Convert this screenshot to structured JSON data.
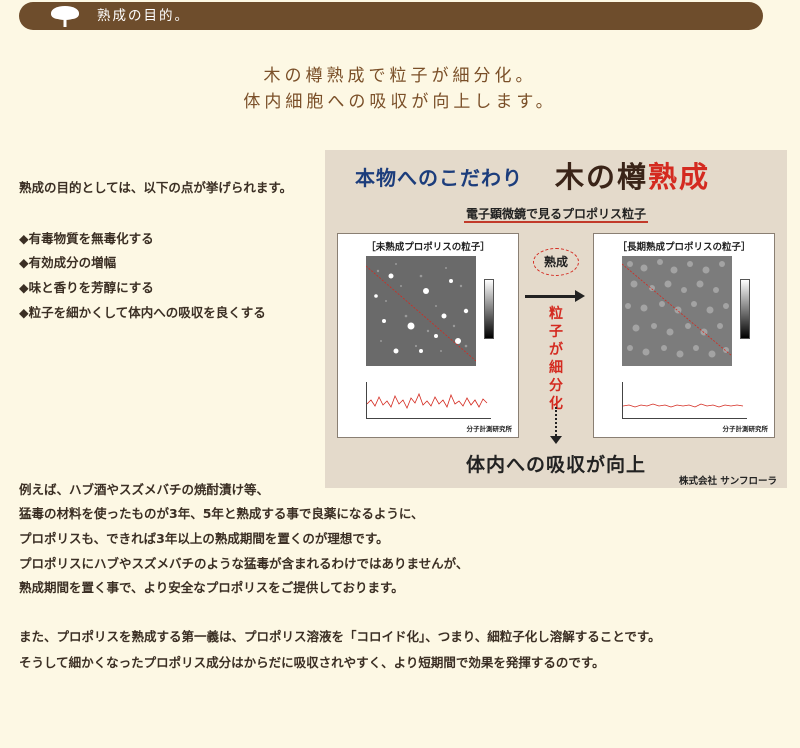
{
  "header": {
    "title": "熟成の目的。"
  },
  "headline": {
    "line1": "木の樽熟成で粒子が細分化。",
    "line2": "体内細胞への吸収が向上します。"
  },
  "intro": "熟成の目的としては、以下の点が挙げられます。",
  "purposes": [
    "◆有毒物質を無毒化する",
    "◆有効成分の増幅",
    "◆味と香りを芳醇にする",
    "◆粒子を細かくして体内への吸収を良くする"
  ],
  "paragraph1": [
    "例えば、ハブ酒やスズメバチの焼酎漬け等、",
    "猛毒の材料を使ったものが3年、5年と熟成する事で良薬になるように、",
    "プロポリスも、できれば3年以上の熟成期間を置くのが理想です。",
    "プロポリスにハブやスズメバチのような猛毒が含まれるわけではありませんが、",
    "熟成期間を置く事で、より安全なプロポリスをご提供しております。"
  ],
  "paragraph2": [
    "また、プロポリスを熟成する第一義は、プロポリス溶液を「コロイド化」、つまり、細粒子化し溶解することです。",
    "そうして細かくなったプロポリス成分はからだに吸収されやすく、より短期間で効果を発揮するのです。"
  ],
  "figure": {
    "title_left": "本物へのこだわり",
    "title_right_plain": "木の樽",
    "title_right_red": "熟成",
    "subtitle": "電子顕微鏡で見るプロポリス粒子",
    "left_panel_label": "［未熟成プロポリスの粒子］",
    "right_panel_label": "［長期熟成プロポリスの粒子］",
    "credit": "分子計測研究所",
    "bubble": "熟成",
    "vertical_text": "粒子が細分化",
    "bottom_text": "体内への吸収が向上",
    "company": "株式会社 サンフローラ",
    "colors": {
      "accent_red": "#d42a20",
      "title_blue": "#1c3d7c"
    }
  }
}
